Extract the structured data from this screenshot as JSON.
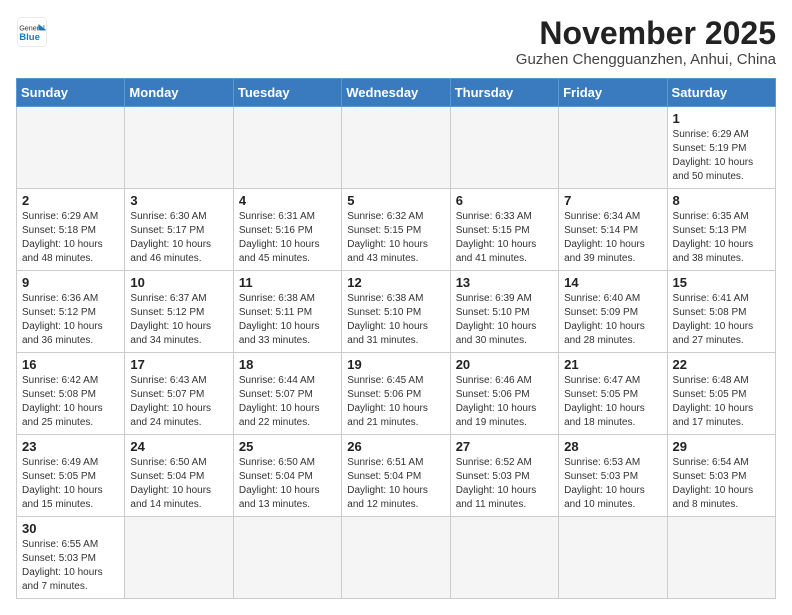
{
  "header": {
    "logo_general": "General",
    "logo_blue": "Blue",
    "month_title": "November 2025",
    "location": "Guzhen Chengguanzhen, Anhui, China"
  },
  "weekdays": [
    "Sunday",
    "Monday",
    "Tuesday",
    "Wednesday",
    "Thursday",
    "Friday",
    "Saturday"
  ],
  "days": [
    {
      "num": "",
      "info": ""
    },
    {
      "num": "",
      "info": ""
    },
    {
      "num": "",
      "info": ""
    },
    {
      "num": "",
      "info": ""
    },
    {
      "num": "",
      "info": ""
    },
    {
      "num": "",
      "info": ""
    },
    {
      "num": "1",
      "info": "Sunrise: 6:29 AM\nSunset: 5:19 PM\nDaylight: 10 hours\nand 50 minutes."
    },
    {
      "num": "2",
      "info": "Sunrise: 6:29 AM\nSunset: 5:18 PM\nDaylight: 10 hours\nand 48 minutes."
    },
    {
      "num": "3",
      "info": "Sunrise: 6:30 AM\nSunset: 5:17 PM\nDaylight: 10 hours\nand 46 minutes."
    },
    {
      "num": "4",
      "info": "Sunrise: 6:31 AM\nSunset: 5:16 PM\nDaylight: 10 hours\nand 45 minutes."
    },
    {
      "num": "5",
      "info": "Sunrise: 6:32 AM\nSunset: 5:15 PM\nDaylight: 10 hours\nand 43 minutes."
    },
    {
      "num": "6",
      "info": "Sunrise: 6:33 AM\nSunset: 5:15 PM\nDaylight: 10 hours\nand 41 minutes."
    },
    {
      "num": "7",
      "info": "Sunrise: 6:34 AM\nSunset: 5:14 PM\nDaylight: 10 hours\nand 39 minutes."
    },
    {
      "num": "8",
      "info": "Sunrise: 6:35 AM\nSunset: 5:13 PM\nDaylight: 10 hours\nand 38 minutes."
    },
    {
      "num": "9",
      "info": "Sunrise: 6:36 AM\nSunset: 5:12 PM\nDaylight: 10 hours\nand 36 minutes."
    },
    {
      "num": "10",
      "info": "Sunrise: 6:37 AM\nSunset: 5:12 PM\nDaylight: 10 hours\nand 34 minutes."
    },
    {
      "num": "11",
      "info": "Sunrise: 6:38 AM\nSunset: 5:11 PM\nDaylight: 10 hours\nand 33 minutes."
    },
    {
      "num": "12",
      "info": "Sunrise: 6:38 AM\nSunset: 5:10 PM\nDaylight: 10 hours\nand 31 minutes."
    },
    {
      "num": "13",
      "info": "Sunrise: 6:39 AM\nSunset: 5:10 PM\nDaylight: 10 hours\nand 30 minutes."
    },
    {
      "num": "14",
      "info": "Sunrise: 6:40 AM\nSunset: 5:09 PM\nDaylight: 10 hours\nand 28 minutes."
    },
    {
      "num": "15",
      "info": "Sunrise: 6:41 AM\nSunset: 5:08 PM\nDaylight: 10 hours\nand 27 minutes."
    },
    {
      "num": "16",
      "info": "Sunrise: 6:42 AM\nSunset: 5:08 PM\nDaylight: 10 hours\nand 25 minutes."
    },
    {
      "num": "17",
      "info": "Sunrise: 6:43 AM\nSunset: 5:07 PM\nDaylight: 10 hours\nand 24 minutes."
    },
    {
      "num": "18",
      "info": "Sunrise: 6:44 AM\nSunset: 5:07 PM\nDaylight: 10 hours\nand 22 minutes."
    },
    {
      "num": "19",
      "info": "Sunrise: 6:45 AM\nSunset: 5:06 PM\nDaylight: 10 hours\nand 21 minutes."
    },
    {
      "num": "20",
      "info": "Sunrise: 6:46 AM\nSunset: 5:06 PM\nDaylight: 10 hours\nand 19 minutes."
    },
    {
      "num": "21",
      "info": "Sunrise: 6:47 AM\nSunset: 5:05 PM\nDaylight: 10 hours\nand 18 minutes."
    },
    {
      "num": "22",
      "info": "Sunrise: 6:48 AM\nSunset: 5:05 PM\nDaylight: 10 hours\nand 17 minutes."
    },
    {
      "num": "23",
      "info": "Sunrise: 6:49 AM\nSunset: 5:05 PM\nDaylight: 10 hours\nand 15 minutes."
    },
    {
      "num": "24",
      "info": "Sunrise: 6:50 AM\nSunset: 5:04 PM\nDaylight: 10 hours\nand 14 minutes."
    },
    {
      "num": "25",
      "info": "Sunrise: 6:50 AM\nSunset: 5:04 PM\nDaylight: 10 hours\nand 13 minutes."
    },
    {
      "num": "26",
      "info": "Sunrise: 6:51 AM\nSunset: 5:04 PM\nDaylight: 10 hours\nand 12 minutes."
    },
    {
      "num": "27",
      "info": "Sunrise: 6:52 AM\nSunset: 5:03 PM\nDaylight: 10 hours\nand 11 minutes."
    },
    {
      "num": "28",
      "info": "Sunrise: 6:53 AM\nSunset: 5:03 PM\nDaylight: 10 hours\nand 10 minutes."
    },
    {
      "num": "29",
      "info": "Sunrise: 6:54 AM\nSunset: 5:03 PM\nDaylight: 10 hours\nand 8 minutes."
    },
    {
      "num": "30",
      "info": "Sunrise: 6:55 AM\nSunset: 5:03 PM\nDaylight: 10 hours\nand 7 minutes."
    },
    {
      "num": "",
      "info": ""
    },
    {
      "num": "",
      "info": ""
    },
    {
      "num": "",
      "info": ""
    },
    {
      "num": "",
      "info": ""
    },
    {
      "num": "",
      "info": ""
    },
    {
      "num": "",
      "info": ""
    }
  ]
}
